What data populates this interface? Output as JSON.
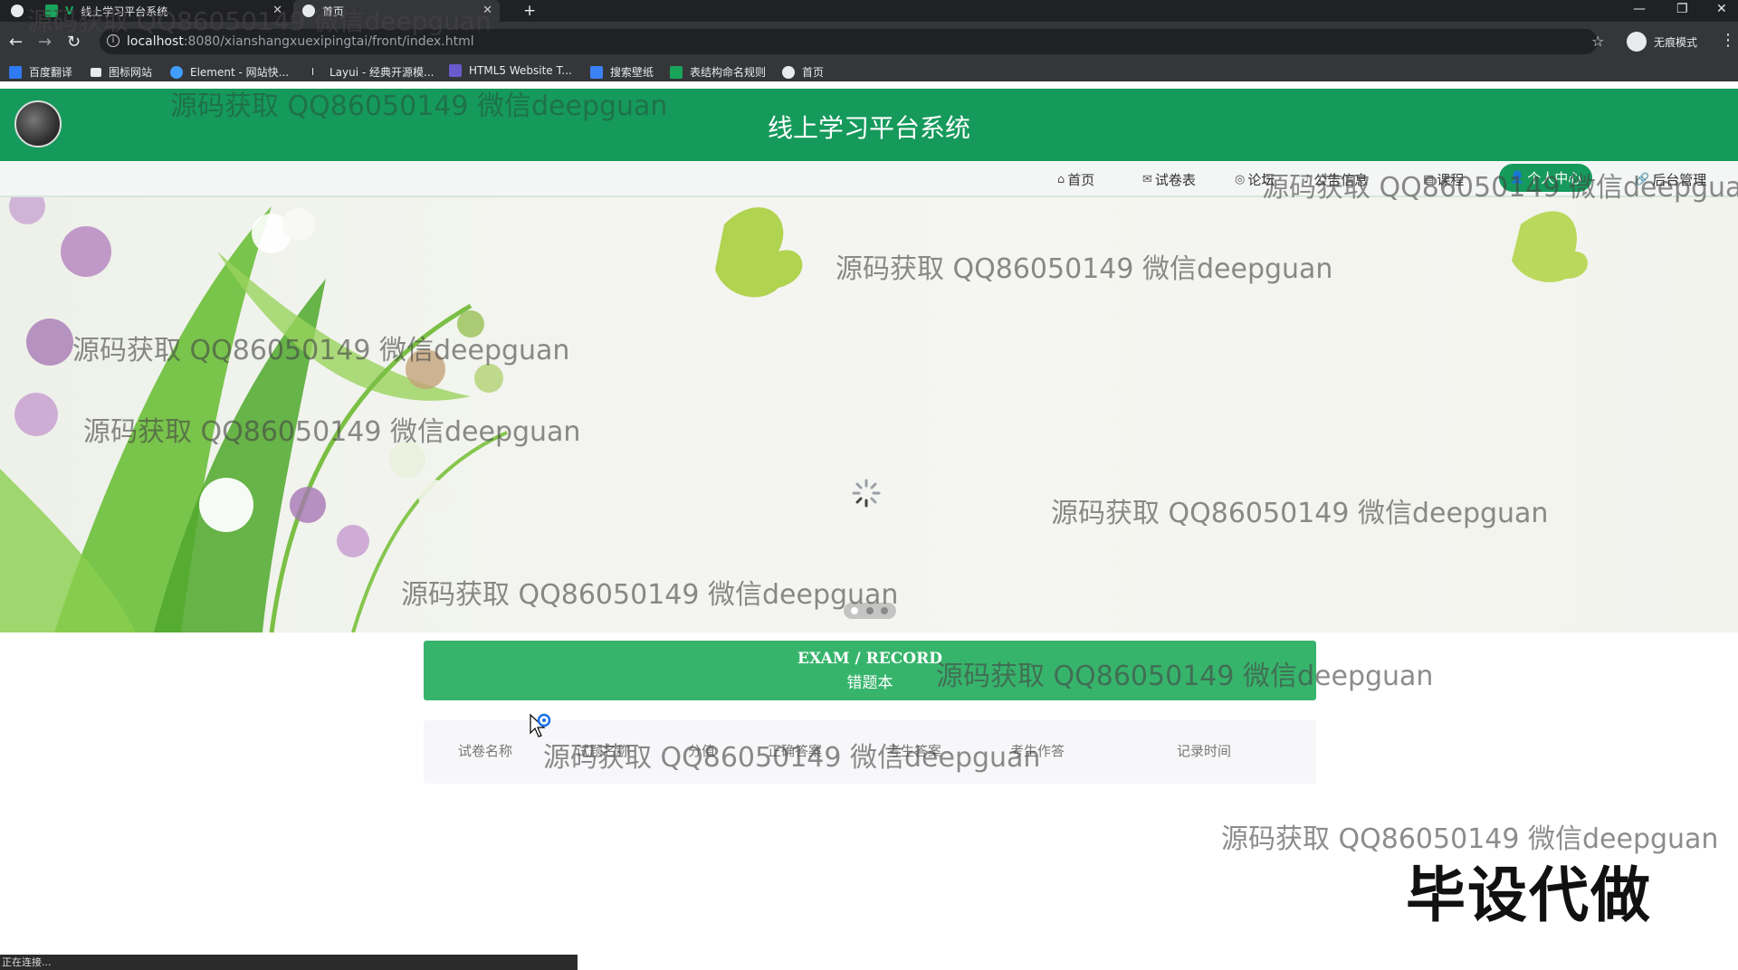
{
  "browser": {
    "tabs": [
      {
        "label": ""
      },
      {
        "label": "线上学习平台系统"
      },
      {
        "label": "首页"
      }
    ],
    "url_host": "localhost",
    "url_path": ":8080/xianshangxuexipingtai/front/index.html",
    "incognito_label": "无痕模式",
    "bookmarks": [
      {
        "label": "百度翻译",
        "color": "#2f7bf5"
      },
      {
        "label": "图标网站",
        "color": "#e8eaed"
      },
      {
        "label": "Element - 网站快...",
        "color": "#409eff"
      },
      {
        "label": "Layui - 经典开源模...",
        "color": "#e8eaed"
      },
      {
        "label": "HTML5 Website T...",
        "color": "#6a5acd"
      },
      {
        "label": "搜索壁纸",
        "color": "#3b82f6"
      },
      {
        "label": "表结构命名规则",
        "color": "#1aa35a"
      },
      {
        "label": "首页",
        "color": "#e8eaed"
      }
    ],
    "status_text": "正在连接..."
  },
  "header": {
    "title": "线上学习平台系统",
    "nav": [
      {
        "label": "首页",
        "icon": "home-icon"
      },
      {
        "label": "试卷表",
        "icon": "mail-icon"
      },
      {
        "label": "论坛",
        "icon": "globe-icon"
      },
      {
        "label": "公告信息",
        "icon": "bell-icon"
      },
      {
        "label": "课程",
        "icon": "book-icon"
      },
      {
        "label": "个人中心",
        "icon": "user-icon"
      },
      {
        "label": "后台管理",
        "icon": "link-icon"
      }
    ]
  },
  "section": {
    "title_en": "EXAM / RECORD",
    "title_cn": "错题本",
    "columns": [
      "试卷名称",
      "试题名称",
      "分值",
      "正确答案",
      "考生答案",
      "考生作答",
      "记录时间"
    ]
  },
  "watermark": "源码获取 QQ86050149 微信deepguan",
  "promo": "毕设代做",
  "colors": {
    "brand": "#159a5b",
    "section": "#37b46c"
  }
}
